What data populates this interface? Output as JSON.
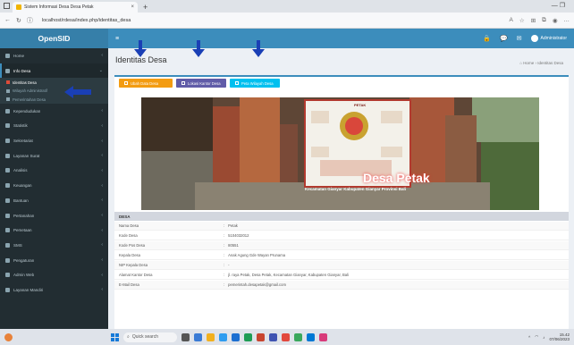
{
  "browser": {
    "tab_title": "Sistem Informasi Desa Desa Petak",
    "tab_close": "×",
    "new_tab": "+",
    "window_controls": "—   ❐",
    "url": "localhost/rdesa/index.php/identitas_desa"
  },
  "app": {
    "logo": "OpenSID"
  },
  "topnav": {
    "menu_icon": "≡",
    "user": "Administrator"
  },
  "sidebar": {
    "items": [
      {
        "label": "Home"
      },
      {
        "label": "Info Desa",
        "active": true,
        "children": [
          {
            "label": "Identitas Desa",
            "current": true
          },
          {
            "label": "Wilayah Administratif"
          },
          {
            "label": "Pemerintahan Desa"
          }
        ]
      },
      {
        "label": "Kependudukan"
      },
      {
        "label": "Statistik"
      },
      {
        "label": "Sekretariat"
      },
      {
        "label": "Layanan Surat"
      },
      {
        "label": "Analisis"
      },
      {
        "label": "Keuangan"
      },
      {
        "label": "Bantuan"
      },
      {
        "label": "Pertanahan"
      },
      {
        "label": "Pemetaan"
      },
      {
        "label": "SMS"
      },
      {
        "label": "Pengaturan"
      },
      {
        "label": "Admin Web"
      },
      {
        "label": "Layanan Mandiri"
      }
    ]
  },
  "page": {
    "title": "Identitas Desa",
    "breadcrumb_home": "Home",
    "breadcrumb_current": "Identitas Desa"
  },
  "buttons": {
    "ubah": "Ubah Data Desa",
    "lokasi": "Lokasi Kantor Desa",
    "peta": "Peta Wilayah Desa"
  },
  "banner": {
    "title": "Desa Petak",
    "subtitle": "Kecamatan Gianyar Kabupaten Gianyar Provinsi Bali",
    "board_title": "PETAK"
  },
  "table": {
    "section": "DESA",
    "rows": [
      {
        "label": "Nama Desa",
        "value": "Petak"
      },
      {
        "label": "Kode Desa",
        "value": "5104032012"
      },
      {
        "label": "Kode Pos Desa",
        "value": "80551"
      },
      {
        "label": "Kepala Desa",
        "value": "Anak Agung Gde Wayan Prunama"
      },
      {
        "label": "NIP Kepala Desa",
        "value": "-"
      },
      {
        "label": "Alamat Kantor Desa",
        "value": "jl. raya Petak, Desa Petak, Kecamatan Gianyar, Kabupaten Gianyar, Bali"
      },
      {
        "label": "E-Mail Desa",
        "value": "pemerintah.desapetak@gmail.com"
      }
    ]
  },
  "taskbar": {
    "search": "Quick search",
    "time": "15.42",
    "date": "07/06/2023"
  },
  "colors": {
    "sidebar": "#222d32",
    "topbar": "#3c8dbc",
    "warning": "#f39c12",
    "purple": "#605ca8",
    "info": "#00c0ef",
    "arrow": "#1a3fb5"
  }
}
